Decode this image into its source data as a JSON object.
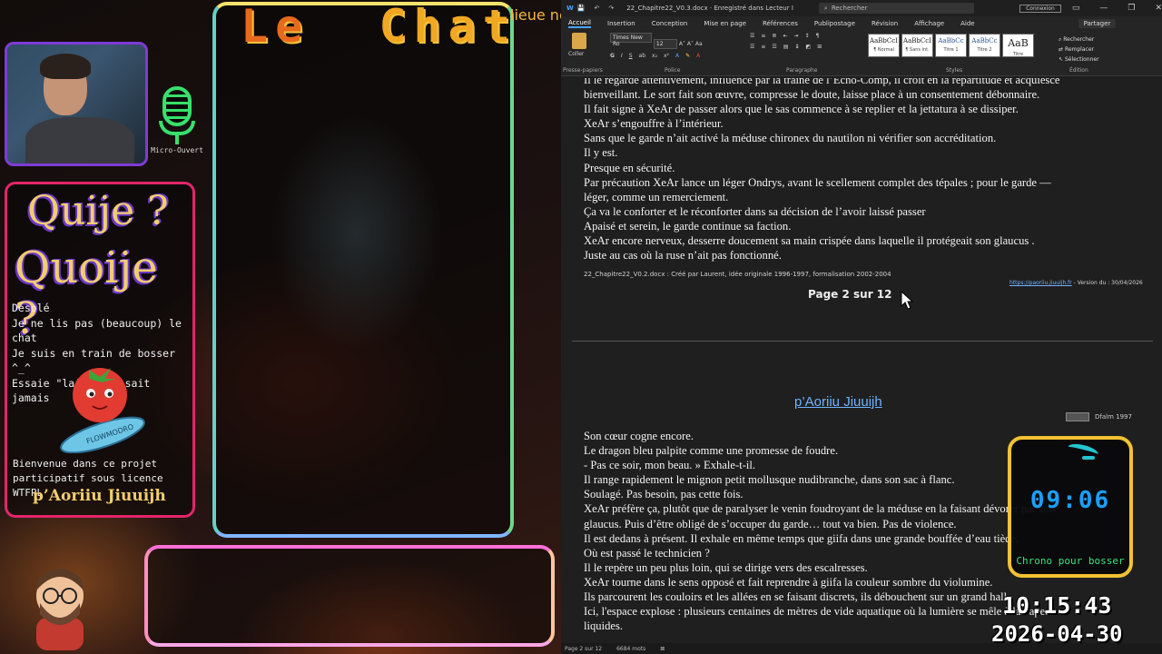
{
  "stream": {
    "chat_title_part1": "Le",
    "chat_title_part2": "Chat",
    "header_snippet": "lieue nord",
    "mic_label": "Micro-Ouvert",
    "quije": "Quije ?",
    "quoije": "Quoije ?",
    "messages": [
      "Désolé",
      "Je ne lis pas (beaucoup) le chat",
      "Je suis en train de bosser ^_^",
      "Essaie \"laide\" on sait jamais"
    ],
    "tomato_badge": "FLOWMODRO",
    "welcome_lines": [
      "Bienvenue dans ce projet",
      "participatif sous licence WTFPL"
    ],
    "author": "p’Aoriiu Jiuuijh"
  },
  "word": {
    "title": "22_Chapitre22_V0.3.docx · Enregistré dans Lecteur I",
    "search_placeholder": "Rechercher",
    "connexion": "Connexion",
    "tabs": [
      "Accueil",
      "Insertion",
      "Conception",
      "Mise en page",
      "Références",
      "Publipostage",
      "Révision",
      "Affichage",
      "Aide"
    ],
    "share": "Partager",
    "font_name": "Times New Ro",
    "font_size": "12",
    "paste": "Coller",
    "groups": {
      "clipboard": "Presse-papiers",
      "police": "Police",
      "paragraphe": "Paragraphe",
      "styles": "Styles",
      "edition": "Édition"
    },
    "styles": [
      {
        "sample": "AaBbCcI",
        "name": "¶ Normal"
      },
      {
        "sample": "AaBbCcI",
        "name": "¶ Sans int."
      },
      {
        "sample": "AaBbCc",
        "name": "Titre 1"
      },
      {
        "sample": "AaBbCc",
        "name": "Titre 2"
      },
      {
        "sample": "AaB",
        "name": "Titre"
      }
    ],
    "edit_links": [
      "Rechercher",
      "Remplacer",
      "Sélectionner"
    ],
    "page1_lines": [
      "Il le regarde attentivement, influencé par la traîne de l’Écho-Comp, il croit en la répartitude et acquiesce",
      "bienveillant. Le sort fait son œuvre, compresse le doute, laisse place à un consentement débonnaire.",
      "Il fait signe à XeAr de passer alors que le sas commence à se replier et la jettatura à se dissiper.",
      "XeAr s’engouffre à l’intérieur.",
      "Sans que le garde n’ait activé la méduse chironex du nautilon ni vérifier son accréditation.",
      "Il y est.",
      "Presque en sécurité.",
      "Par précaution XeAr lance un léger Ondrys, avant le scellement complet des tépales ; pour le garde —",
      "léger, comme un remerciement.",
      "Ça va le conforter et le réconforter dans sa décision de l’avoir laissé passer",
      "Apaisé et serein, le garde continue sa faction.",
      "XeAr encore nerveux, desserre doucement sa main crispée dans laquelle il protégeait son glaucus .",
      "Juste au cas où la ruse n’ait pas fonctionné."
    ],
    "footer_left": "22_Chapitre22_V0.2.docx : Créé par Laurent, idée originale 1996-1997, formalisation 2002-2004",
    "footer_url": "https://paoriiu.jiuuijh.fr",
    "footer_version": " - Version du : 30/04/2026",
    "page_number": "Page 2 sur 12",
    "page3_heading": "p’Aoriiu Jiuuijh",
    "page3_header_right": "Dfalm 1997",
    "page3_lines": [
      "Son cœur cogne encore.",
      "Le dragon bleu palpite comme une promesse de foudre.",
      "     -      Pas ce soir, mon beau. » Exhale-t-il.",
      "Il range rapidement le mignon petit mollusque nudibranche, dans son sac à flanc.",
      "Soulagé. Pas besoin, pas cette fois.",
      "XeAr préfère ça, plutôt que de paralyser le venin foudroyant de la méduse en la faisant dévorer par son",
      "glaucus. Puis d’être obligé de s’occuper du garde… tout va bien. Pas de violence.",
      "Il est dedans à présent. Il exhale en même temps que giifa dans une grande bouffée d’eau tiède.",
      "Où est passé le technicien ?",
      "Il le repère un peu plus loin, qui se dirige vers des escalresses.",
      "XeAr tourne dans le sens opposé et fait reprendre à giifa la couleur sombre du violumine.",
      "Ils parcourent les couloirs et les allées en se faisant discrets, ils débouchent sur un grand hall.",
      "Ici, l'espace explose : plusieurs centaines de mètres de vide aquatique où la lumière se mêle à la vapeur",
      "liquides."
    ],
    "status": [
      "Page 2 sur 12",
      "6684 mots"
    ]
  },
  "overlays": {
    "chrono_time": "09:06",
    "chrono_label": "Chrono pour bosser",
    "clock": "10:15:43",
    "date": "2026-04-30"
  },
  "colors": {
    "link": "#4aa7ff",
    "chrono_time": "#1aa0ff",
    "chrono_label": "#3be07a",
    "title_orange": "#e76a1c"
  }
}
